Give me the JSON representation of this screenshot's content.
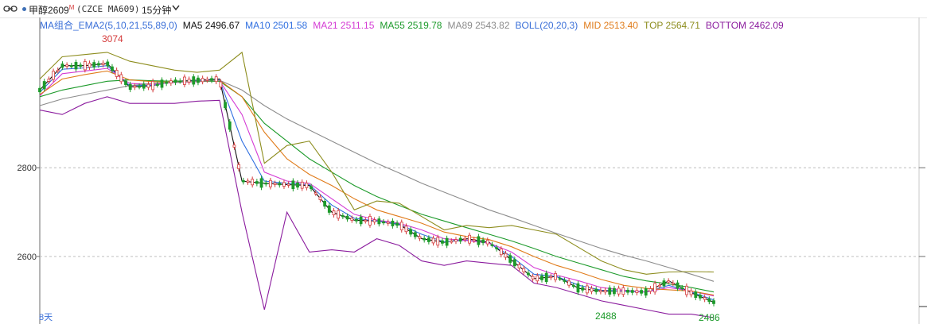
{
  "toolbar": {
    "symbol": "甲醇2609",
    "symbol_sup": "M",
    "exchange_code": "(CZCE MA609)",
    "period": "15分钟"
  },
  "indicators": [
    {
      "label": "MA组合_EMA2(5,10,21,55,89,0)",
      "color": "#3a6fd8"
    },
    {
      "label": "MA5 2496.67",
      "color": "#111111"
    },
    {
      "label": "MA10 2501.58",
      "color": "#2f6fe0"
    },
    {
      "label": "MA21 2511.15",
      "color": "#d43ad4"
    },
    {
      "label": "MA55 2519.78",
      "color": "#1c9a2a"
    },
    {
      "label": "MA89 2543.82",
      "color": "#8c8c8c"
    },
    {
      "label": "BOLL(20,20,3)",
      "color": "#3a6fd8"
    },
    {
      "label": "MID 2513.40",
      "color": "#e07b1a"
    },
    {
      "label": "TOP 2564.71",
      "color": "#8d8d1e"
    },
    {
      "label": "BOTTOM 2462.09",
      "color": "#8b1c9e"
    }
  ],
  "annotations": {
    "high_label": "3074",
    "low_label_1": "2488",
    "low_label_2": "2486",
    "day_marker": "8天"
  },
  "chart_data": {
    "type": "line",
    "title": "",
    "xlabel": "",
    "ylabel": "",
    "yticks": [
      2800,
      2600
    ],
    "ylim": [
      2455,
      3110
    ],
    "x": [
      0,
      1,
      2,
      3,
      4,
      5,
      6,
      7,
      8,
      9,
      10,
      11,
      12,
      13,
      14,
      15,
      16,
      17,
      18,
      19,
      20,
      21,
      22,
      23,
      24,
      25,
      26,
      27,
      28,
      29,
      30
    ],
    "series": [
      {
        "name": "MA5",
        "color": "#111111",
        "values": [
          2975,
          3030,
          3030,
          3035,
          2982,
          2985,
          2995,
          2997,
          3000,
          2770,
          2765,
          2762,
          2760,
          2700,
          2682,
          2680,
          2672,
          2640,
          2632,
          2640,
          2632,
          2592,
          2550,
          2555,
          2528,
          2522,
          2522,
          2520,
          2545,
          2518,
          2497
        ]
      },
      {
        "name": "MA10",
        "color": "#2f6fe0",
        "values": [
          2970,
          3022,
          3025,
          3030,
          2985,
          2986,
          2994,
          2996,
          2998,
          2860,
          2770,
          2765,
          2762,
          2716,
          2686,
          2680,
          2673,
          2650,
          2633,
          2637,
          2630,
          2600,
          2560,
          2555,
          2535,
          2524,
          2522,
          2520,
          2535,
          2520,
          2502
        ]
      },
      {
        "name": "MA21",
        "color": "#d43ad4",
        "values": [
          2962,
          3012,
          3018,
          3024,
          2990,
          2988,
          2992,
          2994,
          2996,
          2920,
          2790,
          2770,
          2765,
          2730,
          2695,
          2682,
          2675,
          2660,
          2640,
          2636,
          2630,
          2610,
          2575,
          2558,
          2545,
          2530,
          2524,
          2520,
          2530,
          2522,
          2511
        ]
      },
      {
        "name": "MA55",
        "color": "#1c9a2a",
        "values": [
          2960,
          2975,
          2985,
          2995,
          2998,
          2996,
          2995,
          2995,
          2995,
          2960,
          2900,
          2860,
          2820,
          2790,
          2760,
          2735,
          2715,
          2695,
          2680,
          2665,
          2650,
          2635,
          2618,
          2600,
          2585,
          2570,
          2555,
          2545,
          2538,
          2530,
          2520
        ]
      },
      {
        "name": "MID",
        "color": "#e07b1a",
        "values": [
          2965,
          3000,
          3010,
          3018,
          2998,
          2994,
          2993,
          2995,
          2997,
          2960,
          2880,
          2820,
          2785,
          2760,
          2730,
          2705,
          2690,
          2675,
          2655,
          2645,
          2638,
          2622,
          2600,
          2580,
          2565,
          2548,
          2535,
          2528,
          2525,
          2522,
          2513
        ]
      },
      {
        "name": "MA89",
        "color": "#8c8c8c",
        "values": [
          2940,
          2955,
          2965,
          2975,
          2985,
          2990,
          2993,
          2995,
          2997,
          2975,
          2940,
          2910,
          2885,
          2860,
          2835,
          2810,
          2788,
          2765,
          2745,
          2725,
          2705,
          2688,
          2670,
          2652,
          2635,
          2618,
          2603,
          2590,
          2575,
          2560,
          2544
        ]
      },
      {
        "name": "TOP",
        "color": "#8d8d1e",
        "values": [
          3000,
          3050,
          3055,
          3060,
          3040,
          3030,
          3020,
          3015,
          3020,
          3060,
          2810,
          2850,
          2860,
          2790,
          2705,
          2725,
          2720,
          2690,
          2660,
          2670,
          2665,
          2670,
          2660,
          2650,
          2620,
          2590,
          2570,
          2560,
          2565,
          2566,
          2565
        ]
      },
      {
        "name": "BOTTOM",
        "color": "#8b1c9e",
        "values": [
          2930,
          2920,
          2945,
          2960,
          2945,
          2945,
          2945,
          2950,
          2952,
          2700,
          2480,
          2700,
          2610,
          2615,
          2610,
          2640,
          2625,
          2590,
          2580,
          2590,
          2585,
          2580,
          2540,
          2530,
          2515,
          2500,
          2490,
          2480,
          2470,
          2470,
          2462
        ]
      }
    ]
  }
}
